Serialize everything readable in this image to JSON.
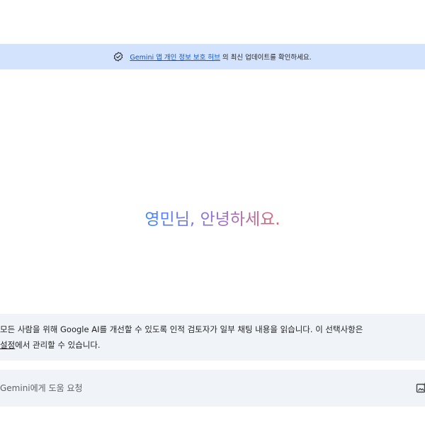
{
  "banner": {
    "link_text": "Gemini 앱 개인 정보 보호 허브",
    "suffix_text": "의 최신 업데이트를 확인하세요."
  },
  "greeting": {
    "text": "영민님, 안녕하세요."
  },
  "notice": {
    "line1": "모든 사람을 위해 Google AI를 개선할 수 있도록 인적 검토자가 일부 채팅 내용을 읽습니다. 이 선택사항은",
    "settings_link": "설정",
    "line2_rest": "에서 관리할 수 있습니다."
  },
  "prompt": {
    "placeholder": "Gemini에게 도움 요청"
  },
  "colors": {
    "banner_bg": "#d3e3fd",
    "link": "#0b57d0",
    "panel_bg": "#f0f4f9",
    "gradient_start": "#4285f4",
    "gradient_mid": "#9b72cb",
    "gradient_end": "#d96570"
  },
  "icons": {
    "banner_icon": "verified-shield-check-icon",
    "upload_icon": "image-upload-icon"
  }
}
